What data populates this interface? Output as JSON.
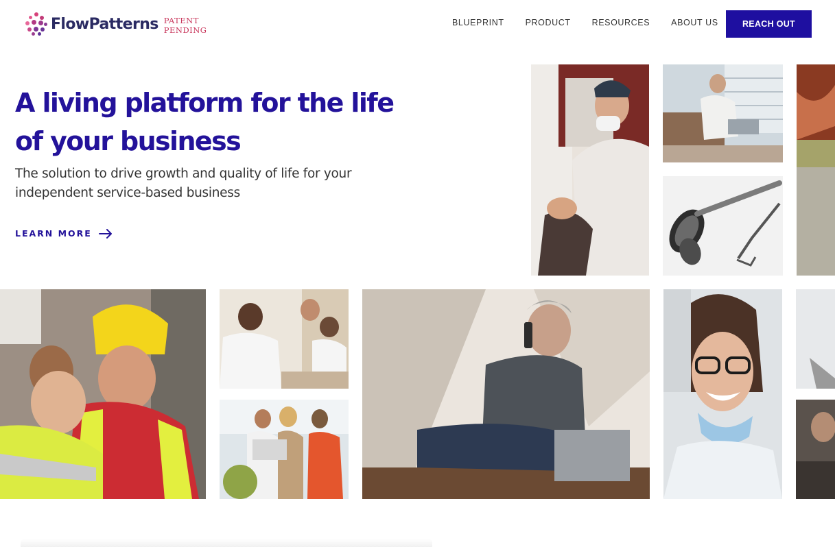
{
  "header": {
    "logo_text": "FlowPatterns",
    "patent_line1": "PATENT",
    "patent_line2": "PENDING",
    "nav": [
      {
        "label": "BLUEPRINT"
      },
      {
        "label": "PRODUCT"
      },
      {
        "label": "RESOURCES"
      },
      {
        "label": "ABOUT US"
      }
    ],
    "cta_label": "REACH OUT"
  },
  "hero": {
    "title": "A living platform for the life of your business",
    "subtitle": "The solution to drive growth and quality of life for your independent service-based business",
    "learn_more": "LEARN MORE"
  },
  "colors": {
    "brand_primary": "#1e0fa0",
    "heading": "#23129a",
    "patent": "#c8365b",
    "logo_text": "#2a2a62"
  },
  "icons": {
    "learn_more": "arrow-right-icon",
    "logo": "dots-sphere-icon"
  }
}
